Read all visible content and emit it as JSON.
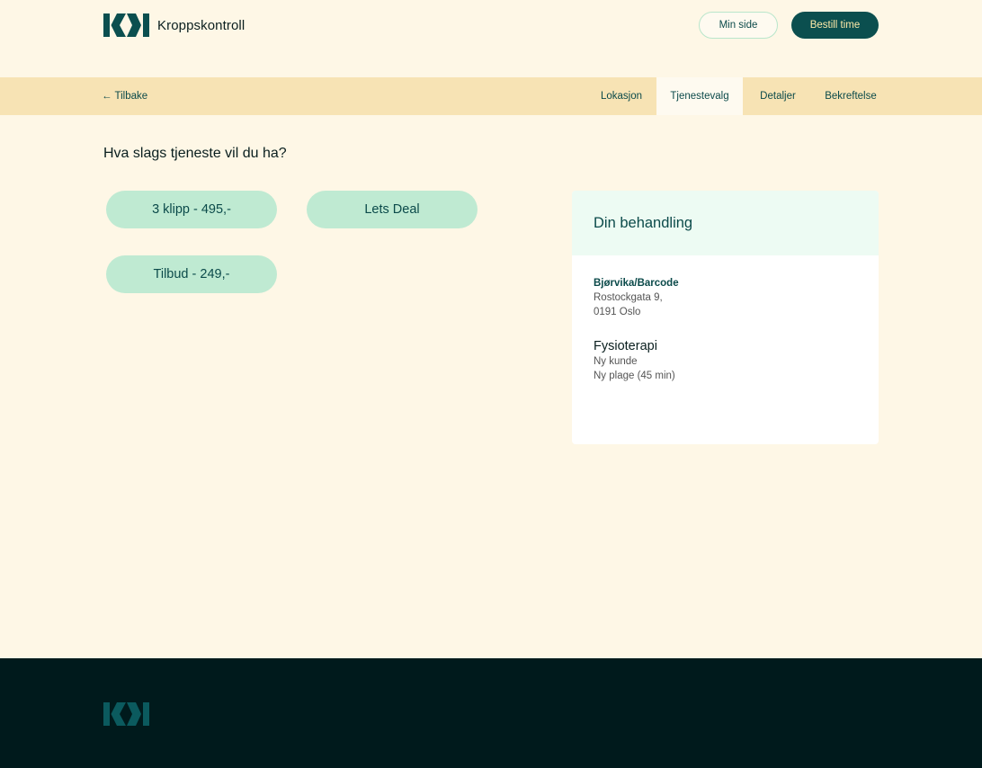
{
  "header": {
    "brand_name": "Kroppskontroll",
    "min_side_label": "Min side",
    "bestill_label": "Bestill time"
  },
  "stepbar": {
    "back_label": "← Tilbake",
    "steps": [
      "Lokasjon",
      "Tjenestevalg",
      "Detaljer",
      "Bekreftelse"
    ],
    "active_step": "Tjenestevalg"
  },
  "main": {
    "question": "Hva slags tjeneste vil du ha?",
    "services": [
      "3 klipp - 495,-",
      "Lets Deal",
      "Tilbud - 249,-"
    ]
  },
  "summary": {
    "title": "Din behandling",
    "location_name": "Bjørvika/Barcode",
    "address_line1": "Rostockgata 9,",
    "address_line2": "0191 Oslo",
    "service_name": "Fysioterapi",
    "service_line1": "Ny kunde",
    "service_line2": "Ny plage (45 min)"
  },
  "colors": {
    "background": "#fef7e6",
    "stepbar": "#f7e3b4",
    "primary": "#0b4f4f",
    "mint": "#bfead2",
    "footer": "#001a1c",
    "footer_logo": "#0b5a5e"
  },
  "icons": [
    "kroppskontroll-logo-icon",
    "back-arrow-icon",
    "footer-logo-icon"
  ]
}
